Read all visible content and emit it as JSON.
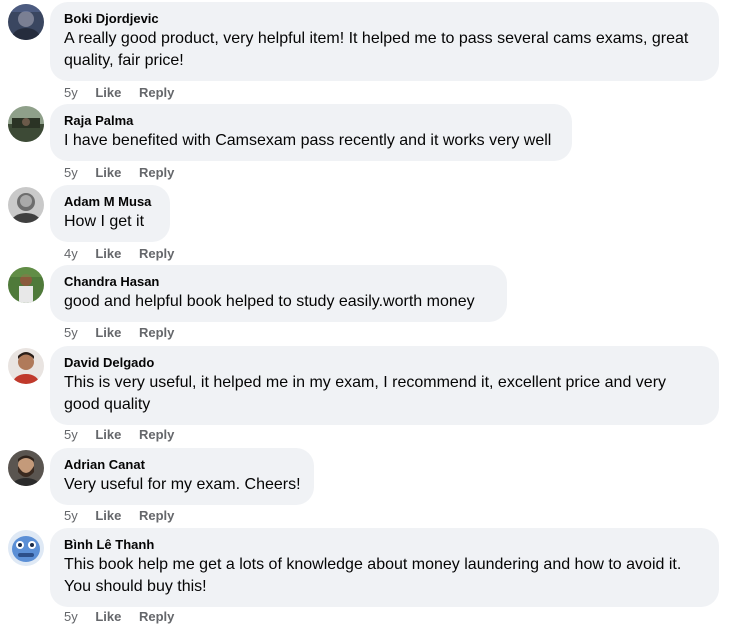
{
  "comments": [
    {
      "author": "Boki Djordjevic",
      "text": "A really good product, very helpful item! It helped me to pass several cams exams, great quality, fair price!",
      "time": "5y",
      "like": "Like",
      "reply": "Reply",
      "avatar": "avatar-dark-photo"
    },
    {
      "author": "Raja Palma",
      "text": "I have benefited with Camsexam pass recently and it works very well",
      "time": "5y",
      "like": "Like",
      "reply": "Reply",
      "avatar": "avatar-landscape-photo"
    },
    {
      "author": "Adam M Musa",
      "text": "How I get it",
      "time": "4y",
      "like": "Like",
      "reply": "Reply",
      "avatar": "avatar-grey-photo"
    },
    {
      "author": "Chandra Hasan",
      "text": "good and helpful book helped to study easily.worth money",
      "time": "5y",
      "like": "Like",
      "reply": "Reply",
      "avatar": "avatar-green-photo"
    },
    {
      "author": "David Delgado",
      "text": "This is very useful, it helped me in my exam, I recommend it, excellent price and very good quality",
      "time": "5y",
      "like": "Like",
      "reply": "Reply",
      "avatar": "avatar-portrait-photo"
    },
    {
      "author": "Adrian Canat",
      "text": "Very useful for my exam. Cheers!",
      "time": "5y",
      "like": "Like",
      "reply": "Reply",
      "avatar": "avatar-bearded-photo"
    },
    {
      "author": "Bình Lê Thanh",
      "text": "This book help me get a lots of knowledge about money laundering and how to avoid it. You should buy this!",
      "time": "5y",
      "like": "Like",
      "reply": "Reply",
      "avatar": "avatar-cartoon-photo"
    }
  ]
}
